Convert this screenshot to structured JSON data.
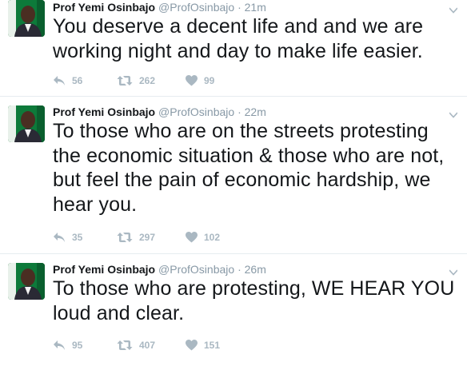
{
  "colors": {
    "text": "#14171a",
    "muted": "#8899a6",
    "action": "#aab8c2",
    "divider": "#e6ecf0"
  },
  "icons": {
    "reply": "reply-icon",
    "retweet": "retweet-icon",
    "like": "heart-icon",
    "menu": "chevron-down-icon"
  },
  "tweets": [
    {
      "name": "Prof Yemi Osinbajo",
      "handle": "@ProfOsinbajo",
      "separator": "·",
      "time": "21m",
      "text": "You deserve a decent life and and we are working night and day to make life easier.",
      "replies": "56",
      "retweets": "262",
      "likes": "99"
    },
    {
      "name": "Prof Yemi Osinbajo",
      "handle": "@ProfOsinbajo",
      "separator": "·",
      "time": "22m",
      "text": "To those who are on the streets protesting the economic situation & those who are not, but feel the pain of economic hardship, we hear you.",
      "replies": "35",
      "retweets": "297",
      "likes": "102"
    },
    {
      "name": "Prof Yemi Osinbajo",
      "handle": "@ProfOsinbajo",
      "separator": "·",
      "time": "26m",
      "text": "To those who are protesting, WE HEAR YOU loud and clear.",
      "replies": "95",
      "retweets": "407",
      "likes": "151"
    }
  ]
}
